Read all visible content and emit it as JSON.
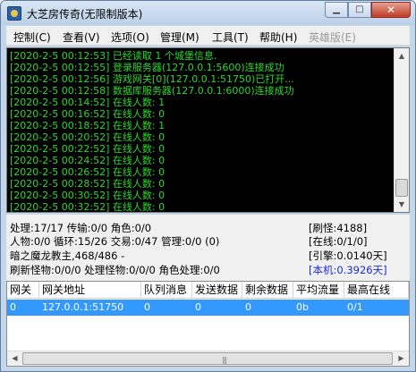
{
  "window": {
    "title": "大芝房传奇(无限制版本)",
    "controls": {
      "minimize": "▁",
      "maximize": "□",
      "close": "✕"
    }
  },
  "menu": [
    {
      "label": "控制(C)",
      "enabled": true
    },
    {
      "label": "查看(V)",
      "enabled": true
    },
    {
      "label": "选项(O)",
      "enabled": true
    },
    {
      "label": "管理(M)",
      "enabled": true
    },
    {
      "label": "工具(T)",
      "enabled": true
    },
    {
      "label": "帮助(H)",
      "enabled": true
    },
    {
      "label": "英雄版(E)",
      "enabled": false
    }
  ],
  "log": [
    "[2020-2-5 00:12:53] 已经读取 1 个城堡信息.",
    "[2020-2-5 00:12:55] 登录服务器(127.0.0.1:5600)连接成功",
    "[2020-2-5 00:12:56] 游戏网关[0](127.0.0.1:51750)已打开...",
    "[2020-2-5 00:12:58] 数据库服务器(127.0.0.1:6000)连接成功",
    "[2020-2-5 00:14:52] 在线人数: 1",
    "[2020-2-5 00:16:52] 在线人数: 0",
    "[2020-2-5 00:18:52] 在线人数: 1",
    "[2020-2-5 00:20:52] 在线人数: 0",
    "[2020-2-5 00:22:52] 在线人数: 0",
    "[2020-2-5 00:24:52] 在线人数: 0",
    "[2020-2-5 00:26:52] 在线人数: 0",
    "[2020-2-5 00:28:52] 在线人数: 0",
    "[2020-2-5 00:30:52] 在线人数: 0",
    "[2020-2-5 00:32:52] 在线人数: 0"
  ],
  "status": {
    "line1": "处理:17/17 传输:0/0 角色:0/0",
    "line2": "人物:0/0 循环:15/26 交易:0/47 管理:0/0 (0)",
    "line3": "暗之魔龙教主,468/486 -",
    "line4": "刷新怪物:0/0/0 处理怪物:0/0/0 角色处理:0/0",
    "refresh_monsters": "[刷怪:4188]",
    "online": "[在线:0/1/0]",
    "engine": "[引擎:0.0140天]",
    "local": "[本机:0.3926天]",
    "local_color": "#1a2bd6"
  },
  "table": {
    "columns": [
      "网关",
      "网关地址",
      "队列消息",
      "发送数据",
      "剩余数据",
      "平均流量",
      "最高在线"
    ],
    "rows": [
      [
        "0",
        "127.0.0.1:51750",
        "0",
        "0",
        "0",
        "0b",
        "0/1"
      ]
    ],
    "scroll_grip": "|||"
  },
  "colors": {
    "log_text": "#2bd82b",
    "log_background": "#000000",
    "selected_row": "#3399ff"
  }
}
